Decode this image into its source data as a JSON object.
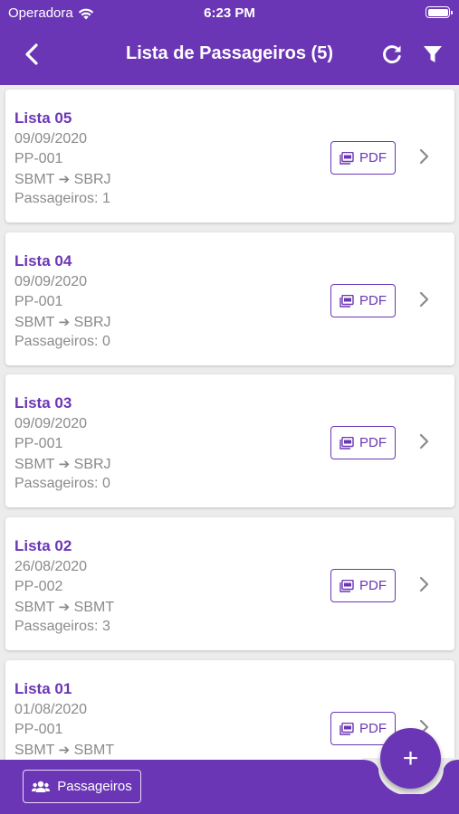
{
  "status_bar": {
    "carrier": "Operadora",
    "time": "6:23 PM"
  },
  "header": {
    "title": "Lista de Passageiros (5)"
  },
  "lists": [
    {
      "name": "Lista 05",
      "date": "09/09/2020",
      "code": "PP-001",
      "origin": "SBMT",
      "destination": "SBRJ",
      "passengers": "Passageiros: 1",
      "pdf_label": "PDF"
    },
    {
      "name": "Lista 04",
      "date": "09/09/2020",
      "code": "PP-001",
      "origin": "SBMT",
      "destination": "SBRJ",
      "passengers": "Passageiros: 0",
      "pdf_label": "PDF"
    },
    {
      "name": "Lista 03",
      "date": "09/09/2020",
      "code": "PP-001",
      "origin": "SBMT",
      "destination": "SBRJ",
      "passengers": "Passageiros: 0",
      "pdf_label": "PDF"
    },
    {
      "name": "Lista 02",
      "date": "26/08/2020",
      "code": "PP-002",
      "origin": "SBMT",
      "destination": "SBMT",
      "passengers": "Passageiros: 3",
      "pdf_label": "PDF"
    },
    {
      "name": "Lista 01",
      "date": "01/08/2020",
      "code": "PP-001",
      "origin": "SBMT",
      "destination": "SBMT",
      "passengers": "",
      "pdf_label": "PDF"
    }
  ],
  "bottom_bar": {
    "passengers_button": "Passageiros",
    "fab_label": "+"
  },
  "icons": {
    "back": "chevron-left-icon",
    "refresh": "refresh-icon",
    "filter": "filter-icon",
    "pdf": "pdf-file-icon",
    "row_arrow": "chevron-right-icon",
    "users": "users-icon",
    "wifi": "wifi-icon",
    "battery": "battery-icon"
  },
  "colors": {
    "primary": "#6b36b5",
    "background": "#ececec",
    "muted_text": "#8a8a8a"
  }
}
